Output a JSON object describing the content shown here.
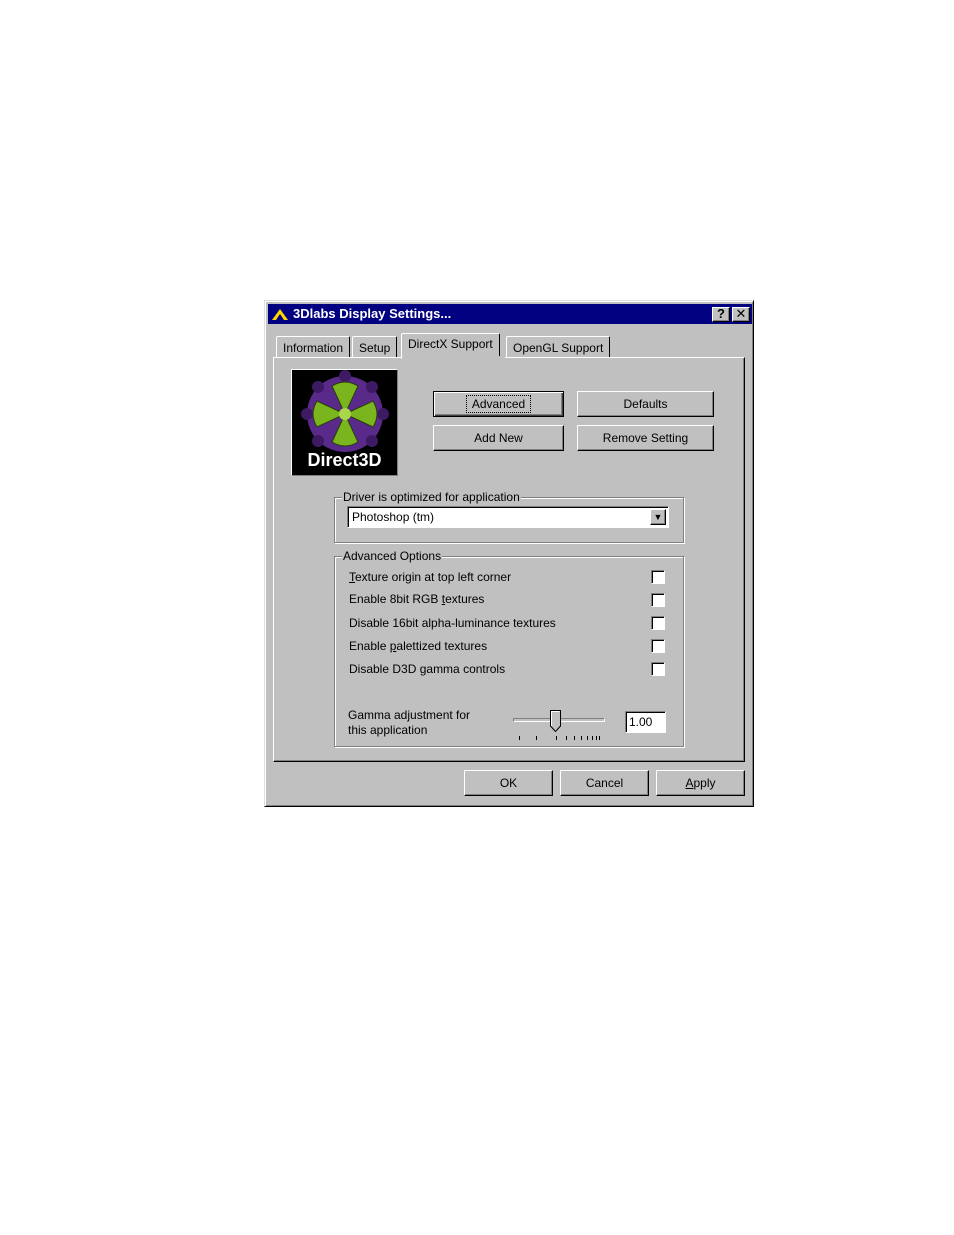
{
  "window": {
    "title": "3Dlabs Display Settings...",
    "help_glyph": "?",
    "close_glyph": "✕"
  },
  "tabs": [
    {
      "label": "Information",
      "active": false
    },
    {
      "label": "Setup",
      "active": false
    },
    {
      "label": "DirectX Support",
      "active": true
    },
    {
      "label": "OpenGL Support",
      "active": false
    }
  ],
  "logo": {
    "text": "Direct3D",
    "colors": {
      "primary": "#7ab51d",
      "secondary": "#5a2a8a"
    }
  },
  "buttons": {
    "advanced": "Advanced",
    "defaults": "Defaults",
    "add_new": "Add New",
    "remove_setting": "Remove Setting"
  },
  "driver_group": {
    "label": "Driver is optimized for application",
    "selected": "Photoshop (tm)"
  },
  "advanced_options": {
    "label": "Advanced Options",
    "items": [
      {
        "pre": "",
        "key": "T",
        "post": "exture origin at top left corner",
        "checked": false
      },
      {
        "pre": "Enable 8bit RGB ",
        "key": "t",
        "post": "extures",
        "checked": false
      },
      {
        "pre": "Disable 16bit alpha-luminance textures",
        "key": "",
        "post": "",
        "checked": false
      },
      {
        "pre": "Enable ",
        "key": "p",
        "post": "alettized textures",
        "checked": false
      },
      {
        "pre": "Disable D3D ",
        "key": "g",
        "post": "amma controls",
        "checked": false
      }
    ],
    "gamma": {
      "label_line1": "Gamma adjustment for",
      "label_line2": "this application",
      "value": "1.00"
    }
  },
  "footer": {
    "ok": "OK",
    "cancel": "Cancel",
    "apply_key": "A",
    "apply_rest": "pply"
  },
  "colors": {
    "face": "#c0c0c0",
    "titlebar": "#000080"
  }
}
